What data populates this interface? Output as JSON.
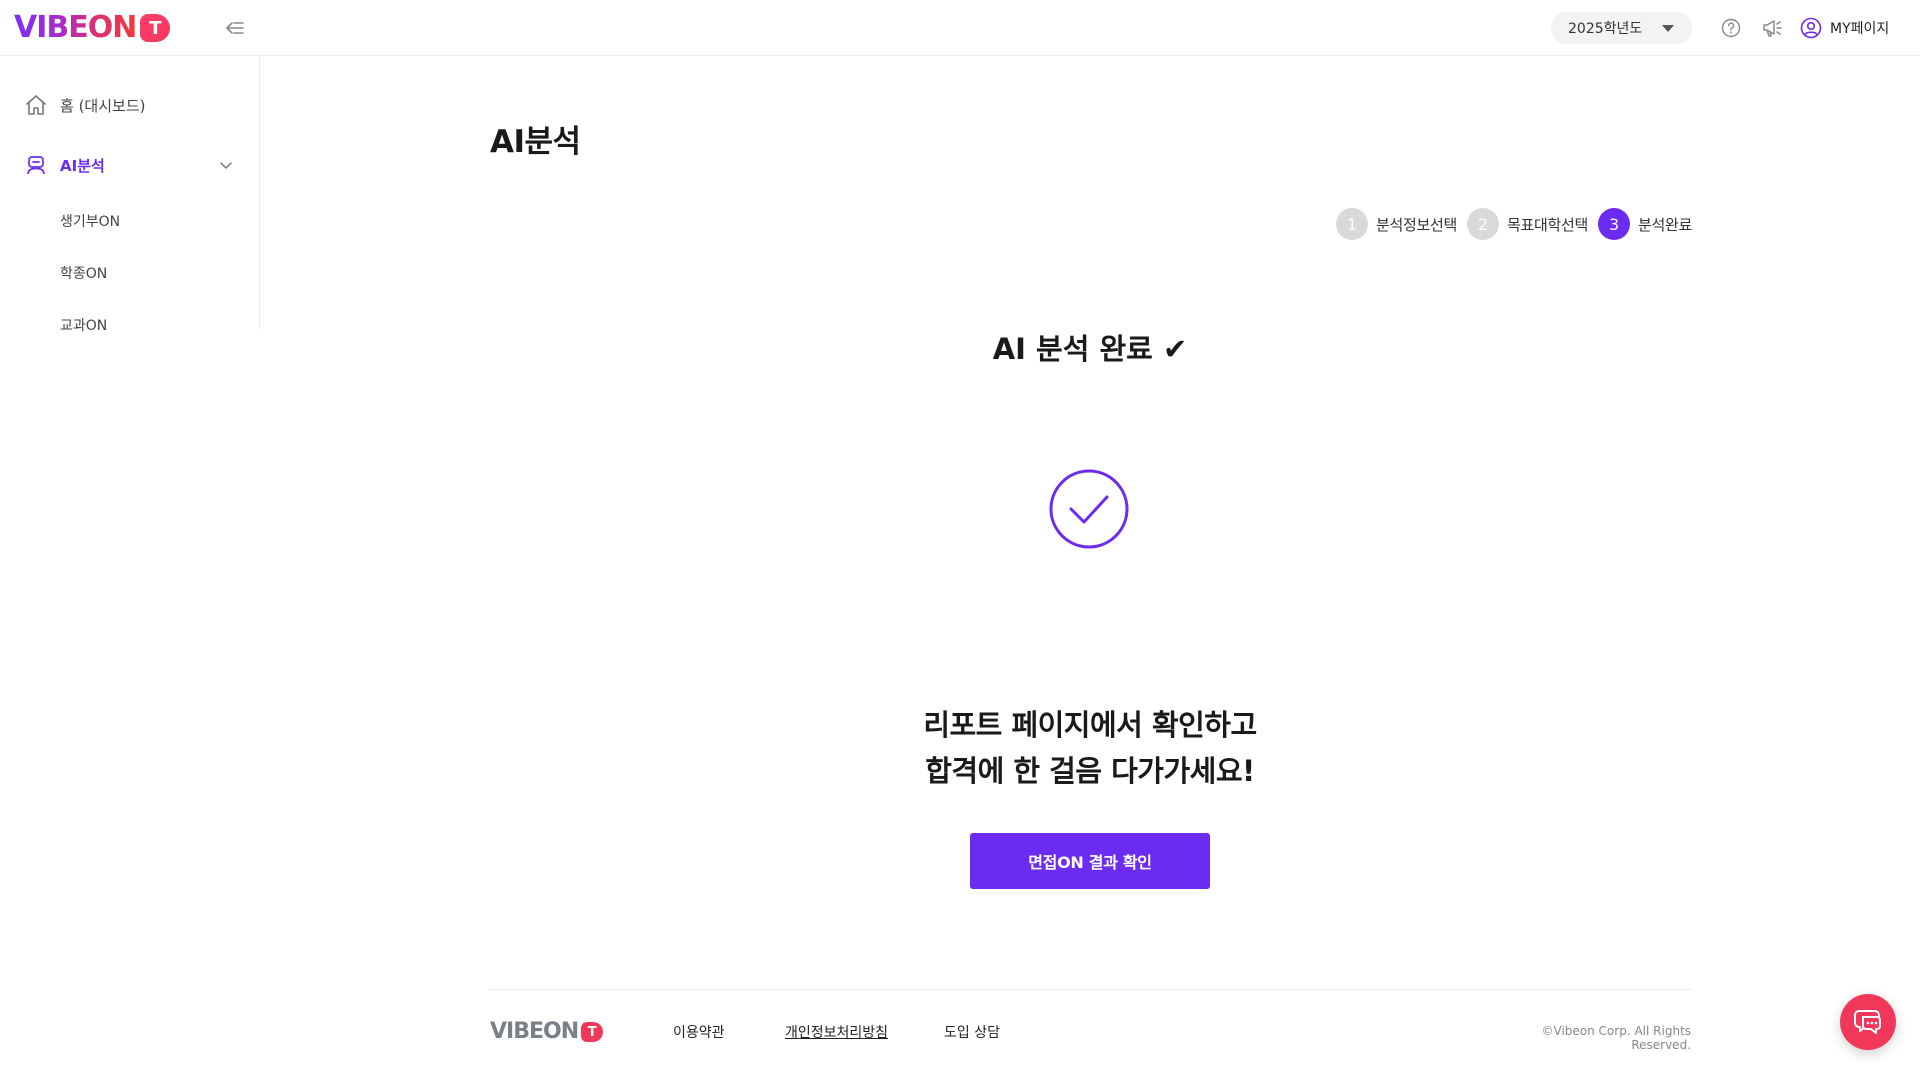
{
  "header": {
    "logo_text": "VIBEON",
    "logo_badge": "T",
    "year_select": "2025학년도",
    "mypage_label": "MY페이지"
  },
  "sidebar": {
    "items": [
      {
        "label": "홈 (대시보드)",
        "icon": "home-icon"
      },
      {
        "label": "AI분석",
        "icon": "robot-icon",
        "active": true
      }
    ],
    "sub_items": [
      {
        "label": "생기부ON"
      },
      {
        "label": "학종ON"
      },
      {
        "label": "교과ON"
      }
    ]
  },
  "main": {
    "page_title": "AI분석",
    "steps": [
      {
        "num": "1",
        "label": "분석정보선택",
        "active": false
      },
      {
        "num": "2",
        "label": "목표대학선택",
        "active": false
      },
      {
        "num": "3",
        "label": "분석완료",
        "active": true
      }
    ],
    "done_title": "AI 분석 완료 ✔",
    "message_line1": "리포트 페이지에서 확인하고",
    "message_line2": "합격에 한 걸음 다가가세요!",
    "cta_label": "면접ON 결과 확인"
  },
  "footer": {
    "logo_text": "VIBEON",
    "logo_badge": "T",
    "links": [
      "이용약관",
      "개인정보처리방침",
      "도입 상담"
    ],
    "copyright": "©Vibeon Corp. All Rights Reserved."
  },
  "colors": {
    "accent": "#6c2bf0",
    "brand_red": "#f2385a",
    "step_inactive": "#d9d9d9"
  }
}
